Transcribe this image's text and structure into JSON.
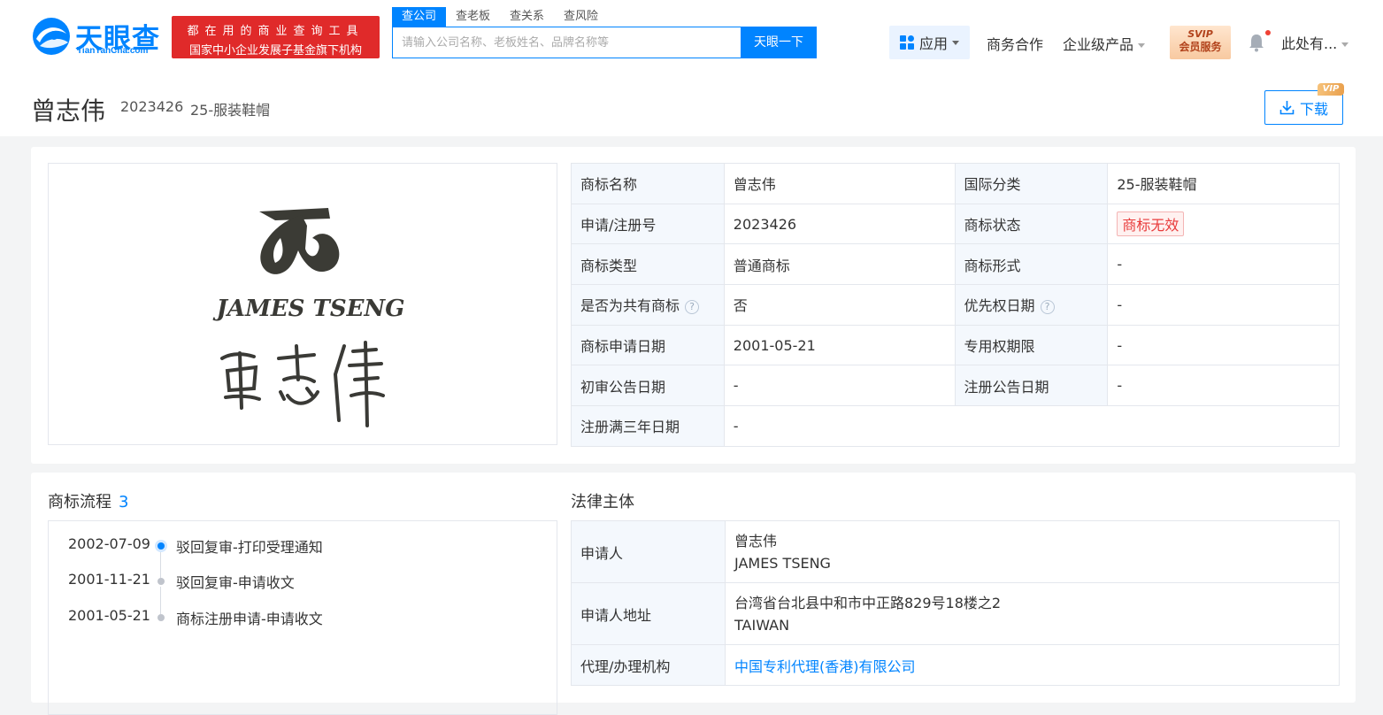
{
  "header": {
    "logo_text": "天眼查",
    "logo_sub": "TianYanCha.com",
    "promo_line1": "都在用的商业查询工具",
    "promo_line2": "国家中小企业发展子基金旗下机构",
    "search_tabs": [
      "查公司",
      "查老板",
      "查关系",
      "查风险"
    ],
    "search_placeholder": "请输入公司名称、老板姓名、品牌名称等",
    "search_button": "天眼一下",
    "nav_app": "应用",
    "nav_business": "商务合作",
    "nav_enterprise": "企业级产品",
    "svip_line1": "SVIP",
    "svip_line2": "会员服务",
    "user_name": "此处有..."
  },
  "trademark": {
    "title": "曾志伟",
    "reg_no": "2023426",
    "category": "25-服装鞋帽",
    "download_label": "下载",
    "vip_tag": "VIP",
    "image_text": "JAMES TSENG"
  },
  "info": {
    "rows": [
      {
        "k1": "商标名称",
        "v1": "曾志伟",
        "k2": "国际分类",
        "v2": "25-服装鞋帽"
      },
      {
        "k1": "申请/注册号",
        "v1": "2023426",
        "k2": "商标状态",
        "v2": "商标无效"
      },
      {
        "k1": "商标类型",
        "v1": "普通商标",
        "k2": "商标形式",
        "v2": "-"
      },
      {
        "k1": "是否为共有商标",
        "v1": "否",
        "k2": "优先权日期",
        "v2": "-"
      },
      {
        "k1": "商标申请日期",
        "v1": "2001-05-21",
        "k2": "专用权期限",
        "v2": "-"
      },
      {
        "k1": "初审公告日期",
        "v1": "-",
        "k2": "注册公告日期",
        "v2": "-"
      },
      {
        "k1": "注册满三年日期",
        "v1": "-"
      }
    ],
    "help_glyph": "?"
  },
  "flow": {
    "title": "商标流程",
    "count": "3",
    "items": [
      {
        "date": "2002-07-09",
        "text": "驳回复审-打印受理通知"
      },
      {
        "date": "2001-11-21",
        "text": "驳回复审-申请收文"
      },
      {
        "date": "2001-05-21",
        "text": "商标注册申请-申请收文"
      }
    ]
  },
  "legal": {
    "title": "法律主体",
    "applicant_label": "申请人",
    "applicant_line1": "曾志伟",
    "applicant_line2": "JAMES TSENG",
    "address_label": "申请人地址",
    "address_line1": "台湾省台北县中和市中正路829号18楼之2",
    "address_line2": "TAIWAN",
    "agent_label": "代理/办理机构",
    "agent_value": "中国专利代理(香港)有限公司"
  },
  "colors": {
    "brand": "#0084ff",
    "promo_red": "#e02a2a",
    "status_red": "#e83b3b"
  }
}
